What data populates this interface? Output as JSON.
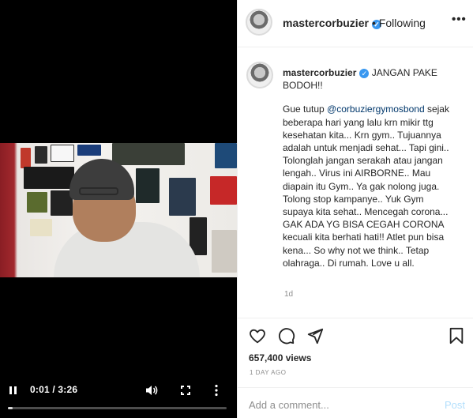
{
  "player": {
    "time": "0:01 / 3:26",
    "progress": 0.005,
    "controls": [
      "pause-icon",
      "volume-icon",
      "fullscreen-icon",
      "more-vertical-icon"
    ]
  },
  "header": {
    "username": "mastercorbuzier",
    "following": "• Following",
    "more": "•••"
  },
  "caption": {
    "username": "mastercorbuzier",
    "headline": "JANGAN PAKE BODOH!!",
    "pre": "Gue tutup ",
    "mention": "@corbuziergymosbond",
    "post": " sejak beberapa hari yang lalu krn mikir ttg kesehatan kita... Krn gym.. Tujuannya adalah untuk menjadi sehat... Tapi gini.. Tolonglah jangan serakah atau jangan lengah.. Virus ini AIRBORNE.. Mau diapain itu Gym.. Ya gak nolong juga. Tolong stop kampanye.. Yuk Gym supaya kita sehat.. Mencegah corona... GAK ADA YG BISA CEGAH CORONA kecuali kita berhati hati!! Atlet pun bisa kena... So why not we think.. Tetap olahraga.. Di rumah. Love u all.",
    "age": "1d"
  },
  "actions": {
    "icons": [
      "heart-icon",
      "comment-icon",
      "share-icon",
      "bookmark-icon"
    ],
    "views": "657,400 views",
    "date": "1 DAY AGO"
  },
  "comment": {
    "placeholder": "Add a comment...",
    "post_label": "Post"
  },
  "colors": {
    "accent": "#3897f0",
    "post_disabled": "#b2dffc",
    "mention": "#00376b"
  }
}
